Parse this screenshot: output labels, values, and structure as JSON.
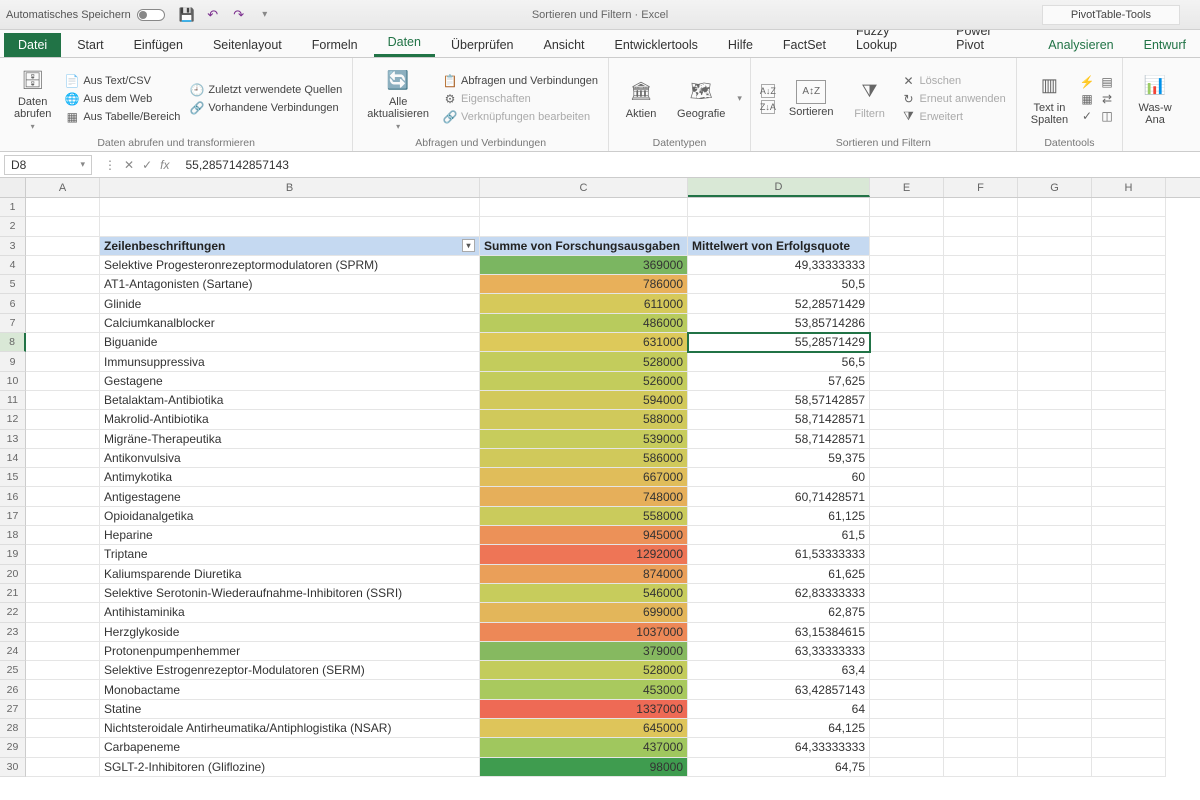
{
  "title_bar": {
    "autosave_label": "Automatisches Speichern",
    "document_title": "Sortieren und Filtern · Excel",
    "pivot_tools": "PivotTable-Tools"
  },
  "tabs": {
    "file": "Datei",
    "items": [
      "Start",
      "Einfügen",
      "Seitenlayout",
      "Formeln",
      "Daten",
      "Überprüfen",
      "Ansicht",
      "Entwicklertools",
      "Hilfe",
      "FactSet",
      "Fuzzy Lookup",
      "Power Pivot"
    ],
    "active": "Daten",
    "pivot": [
      "Analysieren",
      "Entwurf"
    ]
  },
  "ribbon": {
    "get_data_big": "Daten\nabrufen",
    "from_text": "Aus Text/CSV",
    "from_web": "Aus dem Web",
    "from_table": "Aus Tabelle/Bereich",
    "recent_sources": "Zuletzt verwendete Quellen",
    "existing_conn": "Vorhandene Verbindungen",
    "group1": "Daten abrufen und transformieren",
    "refresh_all": "Alle\naktualisieren",
    "queries_conn": "Abfragen und Verbindungen",
    "properties": "Eigenschaften",
    "edit_links": "Verknüpfungen bearbeiten",
    "group2": "Abfragen und Verbindungen",
    "stocks": "Aktien",
    "geo": "Geografie",
    "group3": "Datentypen",
    "sort": "Sortieren",
    "filter": "Filtern",
    "clear": "Löschen",
    "reapply": "Erneut anwenden",
    "advanced": "Erweitert",
    "group4": "Sortieren und Filtern",
    "text_to_cols": "Text in\nSpalten",
    "group5": "Datentools",
    "what_if": "Was-w\nAna"
  },
  "formula_bar": {
    "name_box": "D8",
    "value": "55,2857142857143"
  },
  "columns": [
    "A",
    "B",
    "C",
    "D",
    "E",
    "F",
    "G",
    "H"
  ],
  "pivot_headers": {
    "b": "Zeilenbeschriftungen",
    "c": "Summe von Forschungsausgaben",
    "d": "Mittelwert von Erfolgsquote"
  },
  "data_rows": [
    {
      "n": 4,
      "b": "Selektive Progesteronrezeptormodulatoren (SPRM)",
      "c": "369000",
      "d": "49,33333333",
      "color": "#7bb661"
    },
    {
      "n": 5,
      "b": "AT1-Antagonisten (Sartane)",
      "c": "786000",
      "d": "50,5",
      "color": "#e8b05a"
    },
    {
      "n": 6,
      "b": "Glinide",
      "c": "611000",
      "d": "52,28571429",
      "color": "#d6c95a"
    },
    {
      "n": 7,
      "b": "Calciumkanalblocker",
      "c": "486000",
      "d": "53,85714286",
      "color": "#b8cb5d"
    },
    {
      "n": 8,
      "b": "Biguanide",
      "c": "631000",
      "d": "55,28571429",
      "color": "#ddc95a"
    },
    {
      "n": 9,
      "b": "Immunsuppressiva",
      "c": "528000",
      "d": "56,5",
      "color": "#c3cc5c"
    },
    {
      "n": 10,
      "b": "Gestagene",
      "c": "526000",
      "d": "57,625",
      "color": "#c3cc5c"
    },
    {
      "n": 11,
      "b": "Betalaktam-Antibiotika",
      "c": "594000",
      "d": "58,57142857",
      "color": "#d2c95b"
    },
    {
      "n": 12,
      "b": "Makrolid-Antibiotika",
      "c": "588000",
      "d": "58,71428571",
      "color": "#d0c95b"
    },
    {
      "n": 13,
      "b": "Migräne-Therapeutika",
      "c": "539000",
      "d": "58,71428571",
      "color": "#c7cc5c"
    },
    {
      "n": 14,
      "b": "Antikonvulsiva",
      "c": "586000",
      "d": "59,375",
      "color": "#d0c95b"
    },
    {
      "n": 15,
      "b": "Antimykotika",
      "c": "667000",
      "d": "60",
      "color": "#e0bd5a"
    },
    {
      "n": 16,
      "b": "Antigestagene",
      "c": "748000",
      "d": "60,71428571",
      "color": "#e6af5a"
    },
    {
      "n": 17,
      "b": "Opioidanalgetika",
      "c": "558000",
      "d": "61,125",
      "color": "#cacb5c"
    },
    {
      "n": 18,
      "b": "Heparine",
      "c": "945000",
      "d": "61,5",
      "color": "#ec9158"
    },
    {
      "n": 19,
      "b": "Triptane",
      "c": "1292000",
      "d": "61,53333333",
      "color": "#ee7556"
    },
    {
      "n": 20,
      "b": "Kaliumsparende Diuretika",
      "c": "874000",
      "d": "61,625",
      "color": "#ea9f59"
    },
    {
      "n": 21,
      "b": "Selektive Serotonin-Wiederaufnahme-Inhibitoren (SSRI)",
      "c": "546000",
      "d": "62,83333333",
      "color": "#c7cc5c"
    },
    {
      "n": 22,
      "b": "Antihistaminika",
      "c": "699000",
      "d": "62,875",
      "color": "#e3b65a"
    },
    {
      "n": 23,
      "b": "Herzglykoside",
      "c": "1037000",
      "d": "63,15384615",
      "color": "#ed8857"
    },
    {
      "n": 24,
      "b": "Protonenpumpenhemmer",
      "c": "379000",
      "d": "63,33333333",
      "color": "#86b960"
    },
    {
      "n": 25,
      "b": "Selektive Estrogenrezeptor-Modulatoren (SERM)",
      "c": "528000",
      "d": "63,4",
      "color": "#c3cc5c"
    },
    {
      "n": 26,
      "b": "Monobactame",
      "c": "453000",
      "d": "63,42857143",
      "color": "#a9c95e"
    },
    {
      "n": 27,
      "b": "Statine",
      "c": "1337000",
      "d": "64",
      "color": "#ee6a55"
    },
    {
      "n": 28,
      "b": "Nichtsteroidale Antirheumatika/Antiphlogistika (NSAR)",
      "c": "645000",
      "d": "64,125",
      "color": "#dec55a"
    },
    {
      "n": 29,
      "b": "Carbapeneme",
      "c": "437000",
      "d": "64,33333333",
      "color": "#a0c75e"
    },
    {
      "n": 30,
      "b": "SGLT-2-Inhibitoren (Gliflozine)",
      "c": "98000",
      "d": "64,75",
      "color": "#3f9c4f"
    }
  ],
  "active_cell": "D8",
  "colors": {
    "excel_green": "#217346"
  }
}
